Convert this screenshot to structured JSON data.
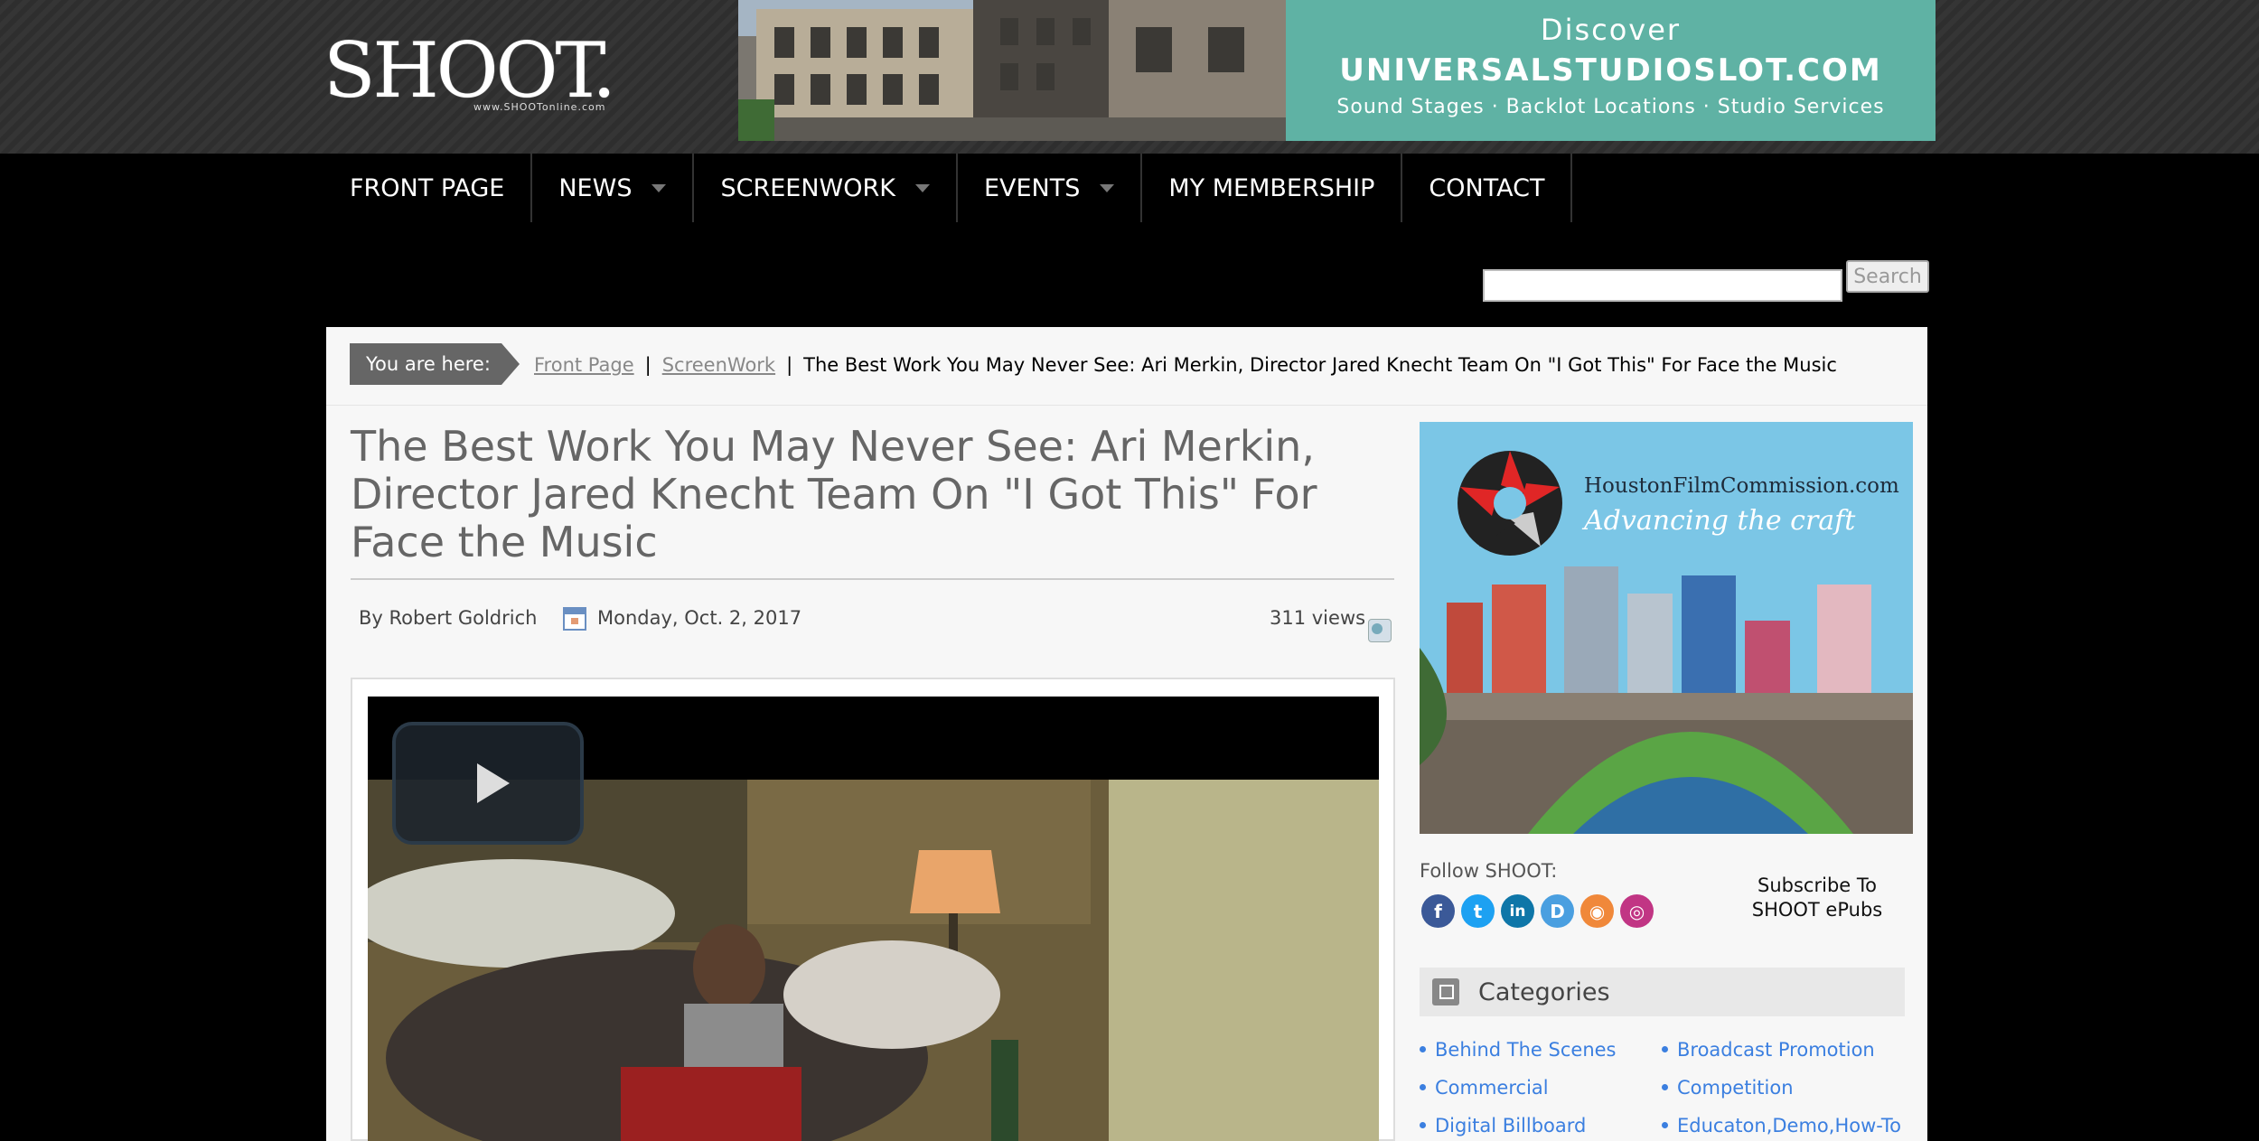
{
  "header": {
    "logo_text": "SHOOT.",
    "logo_sub": "www.SHOOTonline.com",
    "banner": {
      "line1": "Discover",
      "line2": "UNIVERSALSTUDIOSLOT.COM",
      "line3": "Sound Stages · Backlot Locations · Studio Services"
    }
  },
  "nav": {
    "items": [
      {
        "label": "FRONT PAGE",
        "has_dropdown": false
      },
      {
        "label": "NEWS",
        "has_dropdown": true
      },
      {
        "label": "SCREENWORK",
        "has_dropdown": true
      },
      {
        "label": "EVENTS",
        "has_dropdown": true
      },
      {
        "label": "MY MEMBERSHIP",
        "has_dropdown": false
      },
      {
        "label": "CONTACT",
        "has_dropdown": false
      }
    ]
  },
  "search": {
    "value": "",
    "button_label": "Search"
  },
  "breadcrumb": {
    "label": "You are here:",
    "links": [
      "Front Page",
      "ScreenWork"
    ],
    "current": "The Best Work You May Never See: Ari Merkin, Director Jared Knecht Team On \"I Got This\" For Face the Music"
  },
  "article": {
    "title": "The Best Work You May Never See: Ari Merkin, Director Jared Knecht Team On \"I Got This\" For Face the Music",
    "by_label": "By",
    "author": "Robert Goldrich",
    "date": "Monday, Oct. 2, 2017",
    "views": "311 views"
  },
  "sidebar": {
    "ad": {
      "site": "HoustonFilmCommission.com",
      "tagline": "Advancing the craft"
    },
    "follow_label": "Follow SHOOT:",
    "social": [
      {
        "name": "facebook-icon",
        "glyph": "f",
        "color": "#3b5998"
      },
      {
        "name": "twitter-icon",
        "glyph": "t",
        "color": "#1da1f2"
      },
      {
        "name": "linkedin-icon",
        "glyph": "in",
        "color": "#0e76a8"
      },
      {
        "name": "digg-icon",
        "glyph": "D",
        "color": "#4a9fe0"
      },
      {
        "name": "rss-icon",
        "glyph": "◉",
        "color": "#f0883a"
      },
      {
        "name": "instagram-icon",
        "glyph": "◎",
        "color": "#c13584"
      }
    ],
    "subscribe": "Subscribe To SHOOT ePubs",
    "categories_title": "Categories",
    "categories": [
      "Behind The Scenes",
      "Broadcast Promotion",
      "Commercial",
      "Competition",
      "Digital Billboard",
      "Educaton,Demo,How-To"
    ]
  },
  "colors": {
    "accent_link": "#3b7fe0",
    "banner_teal": "#5fb2a4"
  }
}
